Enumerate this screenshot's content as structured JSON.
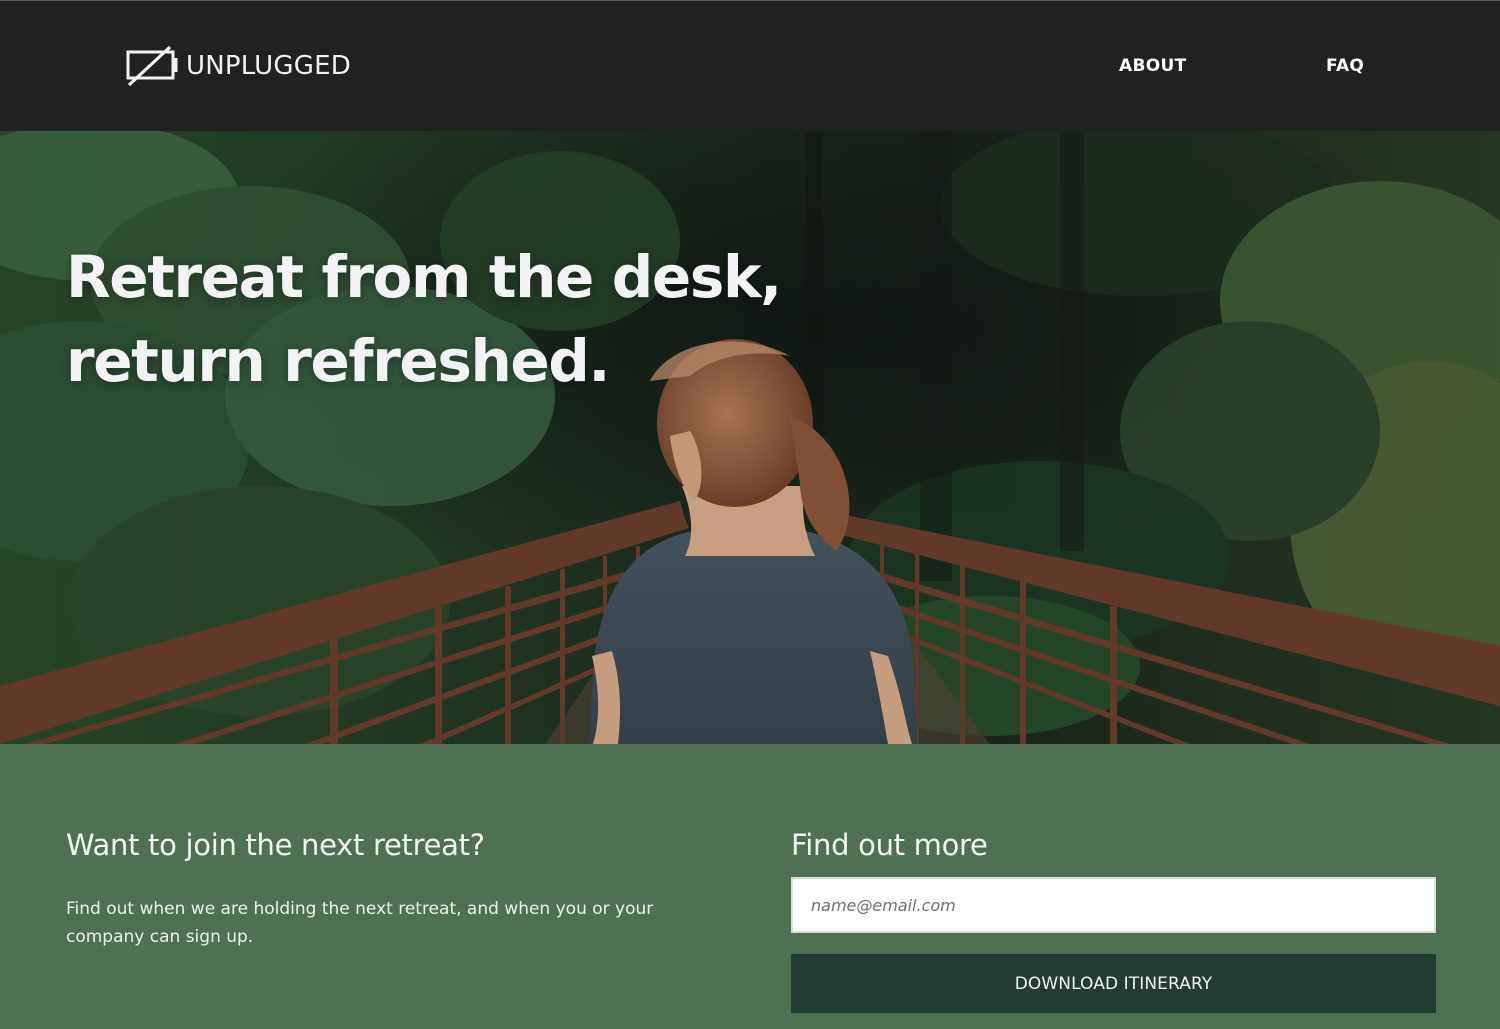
{
  "header": {
    "logo_text": "UNPLUGGED",
    "logo_icon": "unplugged-battery-icon",
    "nav": [
      {
        "label": "ABOUT"
      },
      {
        "label": "FAQ"
      }
    ]
  },
  "hero": {
    "title_line1": "Retreat from the desk,",
    "title_line2": "return refreshed."
  },
  "signup": {
    "heading": "Want to join the next retreat?",
    "text": "Find out when we are holding the next retreat, and when you or your company can sign up.",
    "form_heading": "Find out more",
    "email_placeholder": "name@email.com",
    "email_value": "",
    "button_label": "DOWNLOAD ITINERARY"
  },
  "colors": {
    "header_bg": "#202121",
    "section_bg": "#4f7052",
    "button_bg": "#243b33",
    "text_light": "#f4f4f4"
  }
}
